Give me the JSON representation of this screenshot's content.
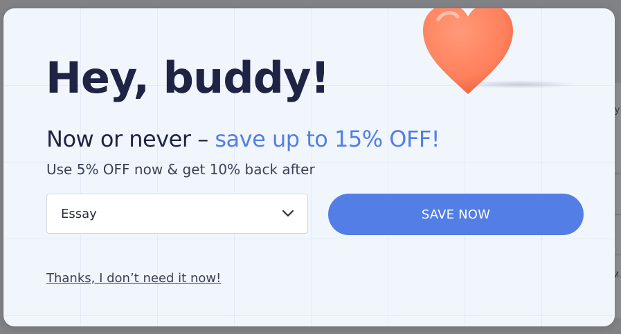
{
  "background": {
    "fragments": [
      "y",
      "M."
    ]
  },
  "popup": {
    "title": "Hey, buddy!",
    "subtitle_plain": "Now or never – ",
    "subtitle_accent": "save up to 15% OFF!",
    "note": "Use 5% OFF now & get 10% back after",
    "select": {
      "value": "Essay",
      "chevron_icon": "chevron-down-icon"
    },
    "save_button_label": "SAVE NOW",
    "decline_link": "Thanks, I don’t need it now!",
    "decoration_icon": "heart-icon"
  },
  "colors": {
    "accent": "#527ee5",
    "title_text": "#1f2444",
    "modal_bg": "#f1f6fd",
    "heart": "#ff7f5b"
  }
}
